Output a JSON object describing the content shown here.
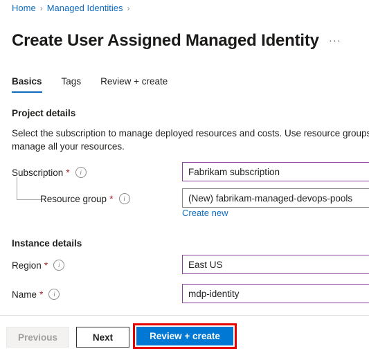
{
  "breadcrumb": {
    "items": [
      {
        "label": "Home"
      },
      {
        "label": "Managed Identities"
      }
    ],
    "separator": "›"
  },
  "header": {
    "title": "Create User Assigned Managed Identity",
    "more_label": "···"
  },
  "tabs": [
    {
      "label": "Basics",
      "active": true
    },
    {
      "label": "Tags",
      "active": false
    },
    {
      "label": "Review + create",
      "active": false
    }
  ],
  "project_details": {
    "heading": "Project details",
    "description": "Select the subscription to manage deployed resources and costs. Use resource groups like manage all your resources.",
    "subscription": {
      "label": "Subscription",
      "required_marker": "*",
      "info_icon": "info-icon",
      "value": "Fabrikam subscription"
    },
    "resource_group": {
      "label": "Resource group",
      "required_marker": "*",
      "info_icon": "info-icon",
      "value": "(New) fabrikam-managed-devops-pools",
      "create_new_label": "Create new"
    }
  },
  "instance_details": {
    "heading": "Instance details",
    "region": {
      "label": "Region",
      "required_marker": "*",
      "info_icon": "info-icon",
      "value": "East US"
    },
    "name": {
      "label": "Name",
      "required_marker": "*",
      "info_icon": "info-icon",
      "value": "mdp-identity"
    }
  },
  "footer": {
    "previous_label": "Previous",
    "next_label": "Next",
    "review_create_label": "Review + create"
  },
  "colors": {
    "link": "#0f6cbd",
    "primary_button": "#0078d4",
    "field_focus_border": "#8a3e9e",
    "field_border": "#8a8886",
    "required_marker": "#a4262c",
    "annotation": "#e60000"
  }
}
